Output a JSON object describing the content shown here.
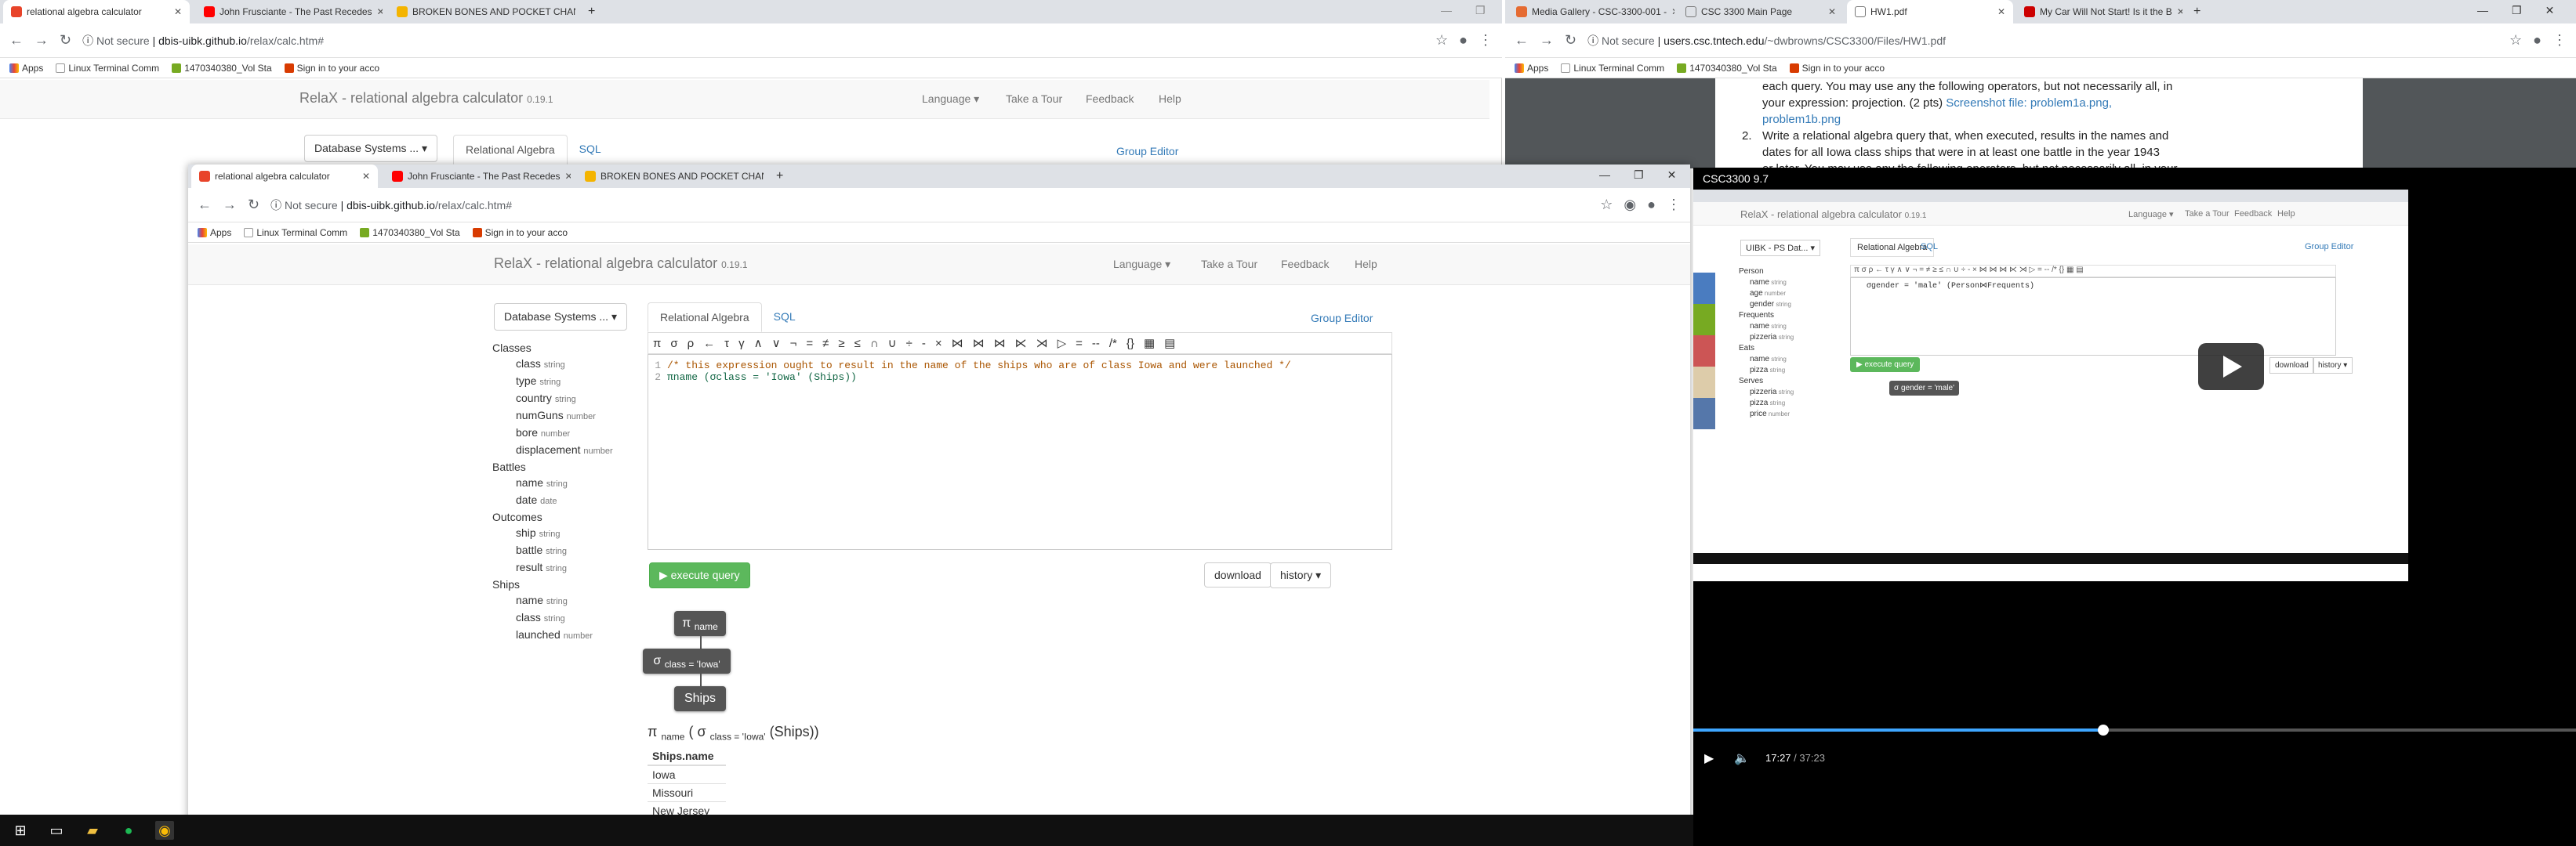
{
  "left_window": {
    "tabs": [
      {
        "title": "relational algebra calculator",
        "fav": "#e8442a",
        "active": true
      },
      {
        "title": "John Frusciante - The Past Recedes",
        "fav": "#f00",
        "active": false
      },
      {
        "title": "BROKEN BONES AND POCKET CHANGE",
        "fav": "#f4b400",
        "active": false
      }
    ],
    "new_tab": "+",
    "url_prefix": "Not secure",
    "url_host": "dbis-uibk.github.io",
    "url_path": "/relax/calc.htm#",
    "bookmarks": [
      "Apps",
      "Linux Terminal Comm",
      "1470340380_Vol Sta",
      "Sign in to your acco"
    ],
    "brand": "RelaX - relational algebra calculator",
    "version": "0.19.1",
    "nav": [
      "Language ▾",
      "Take a Tour",
      "Feedback",
      "Help"
    ],
    "db_button": "Database Systems ... ▾",
    "tab_ra": "Relational Algebra",
    "tab_sql": "SQL",
    "group_editor": "Group Editor"
  },
  "front_window": {
    "tabs": [
      {
        "title": "relational algebra calculator",
        "fav": "#e8442a",
        "active": true
      },
      {
        "title": "John Frusciante - The Past Recedes",
        "fav": "#f00",
        "active": false
      },
      {
        "title": "BROKEN BONES AND POCKET CHANGE",
        "fav": "#f4b400",
        "active": false
      }
    ],
    "new_tab": "+",
    "url_prefix": "Not secure",
    "url_host": "dbis-uibk.github.io",
    "url_path": "/relax/calc.htm#",
    "bookmarks": [
      "Apps",
      "Linux Terminal Comm",
      "1470340380_Vol Sta",
      "Sign in to your acco"
    ],
    "brand": "RelaX - relational algebra calculator",
    "version": "0.19.1",
    "nav": [
      "Language ▾",
      "Take a Tour",
      "Feedback",
      "Help"
    ],
    "db_button": "Database Systems ... ▾",
    "tab_ra": "Relational Algebra",
    "tab_sql": "SQL",
    "group_editor": "Group Editor",
    "schema": [
      {
        "name": "Classes",
        "attrs": [
          [
            "class",
            "string"
          ],
          [
            "type",
            "string"
          ],
          [
            "country",
            "string"
          ],
          [
            "numGuns",
            "number"
          ],
          [
            "bore",
            "number"
          ],
          [
            "displacement",
            "number"
          ]
        ]
      },
      {
        "name": "Battles",
        "attrs": [
          [
            "name",
            "string"
          ],
          [
            "date",
            "date"
          ]
        ]
      },
      {
        "name": "Outcomes",
        "attrs": [
          [
            "ship",
            "string"
          ],
          [
            "battle",
            "string"
          ],
          [
            "result",
            "string"
          ]
        ]
      },
      {
        "name": "Ships",
        "attrs": [
          [
            "name",
            "string"
          ],
          [
            "class",
            "string"
          ],
          [
            "launched",
            "number"
          ]
        ]
      }
    ],
    "operators": [
      "π",
      "σ",
      "ρ",
      "←",
      "τ",
      "γ",
      "∧",
      "∨",
      "¬",
      "=",
      "≠",
      "≥",
      "≤",
      "∩",
      "∪",
      "÷",
      "-",
      "×",
      "⋈",
      "⋈",
      "⋈",
      "⋉",
      "⋊",
      "▷",
      "=",
      "--",
      "/*",
      "{}",
      "▦",
      "▤"
    ],
    "code_line1": "/* this expression ought to result in the name of the ships who are of class Iowa and were launched */",
    "code_line2": "πname (σclass = 'Iowa' (Ships))",
    "execute": "▶ execute query",
    "download": "download",
    "history": "history ▾",
    "tree": {
      "proj": "π",
      "proj_sub": "name",
      "sel": "σ",
      "sel_sub": "class = 'Iowa'",
      "rel": "Ships"
    },
    "result_expr": {
      "pi": "π",
      "pi_sub": "name",
      "sigma": "σ",
      "sigma_sub": "class = 'Iowa'",
      "rel": "(Ships))",
      "open": "(",
      "open2": "("
    },
    "result_header": "Ships.name",
    "result_rows": [
      "Iowa",
      "Missouri",
      "New Jersey"
    ]
  },
  "right_window": {
    "tabs": [
      {
        "title": "Media Gallery - CSC-3300-001 -",
        "fav": "#e56b32",
        "active": false
      },
      {
        "title": "CSC 3300 Main Page",
        "fav": "#777",
        "active": false
      },
      {
        "title": "HW1.pdf",
        "fav": "#777",
        "active": true
      },
      {
        "title": "My Car Will Not Start! Is it the B",
        "fav": "#c00",
        "active": false
      }
    ],
    "new_tab": "+",
    "url_prefix": "Not secure",
    "url_host": "users.csc.tntech.edu",
    "url_path": "/~dwbrowns/CSC3300/Files/HW1.pdf",
    "bookmarks": [
      "Apps",
      "Linux Terminal Comm",
      "1470340380_Vol Sta",
      "Sign in to your acco"
    ],
    "pdf_line1": "each query. You may use any the following operators, but not necessarily all, in",
    "pdf_line2a": "your expression: projection. (2 pts) ",
    "pdf_line2b": "Screenshot file: problem1a.png,",
    "pdf_line3": "problem1b.png",
    "pdf_num": "2.",
    "pdf_line4": "Write a relational algebra query that, when executed, results in the names and",
    "pdf_line5": "dates for all Iowa class ships that were in at least one battle in the year 1943",
    "pdf_line6": "or later. You may use any the following operators, but not necessarily all, in your"
  },
  "video": {
    "title": "CSC3300 9.7",
    "inner_brand": "RelaX - relational algebra calculator",
    "inner_version": "0.19.1",
    "inner_nav": [
      "Language ▾",
      "Take a Tour",
      "Feedback",
      "Help"
    ],
    "inner_db": "UIBK - PS Dat... ▾",
    "inner_tab_ra": "Relational Algebra",
    "inner_tab_sql": "SQL",
    "inner_group_editor": "Group Editor",
    "inner_schema": [
      {
        "name": "Person",
        "attrs": [
          [
            "name",
            "string"
          ],
          [
            "age",
            "number"
          ],
          [
            "gender",
            "string"
          ]
        ]
      },
      {
        "name": "Frequents",
        "attrs": [
          [
            "name",
            "string"
          ],
          [
            "pizzeria",
            "string"
          ]
        ]
      },
      {
        "name": "Eats",
        "attrs": [
          [
            "name",
            "string"
          ],
          [
            "pizza",
            "string"
          ]
        ]
      },
      {
        "name": "Serves",
        "attrs": [
          [
            "pizzeria",
            "string"
          ],
          [
            "pizza",
            "string"
          ],
          [
            "price",
            "number"
          ]
        ]
      }
    ],
    "inner_code": "σgender = 'male' (Person⋈Frequents)",
    "inner_execute": "▶ execute query",
    "inner_download": "download",
    "inner_history": "history ▾",
    "inner_node": "σ gender = 'male'",
    "time_current": "17:27",
    "time_total": "/ 37:23",
    "progress": 0.4644
  },
  "colors": {
    "accent_link": "#337ab7",
    "execute_green": "#5cb85c",
    "progress": "#3ea6ff"
  }
}
